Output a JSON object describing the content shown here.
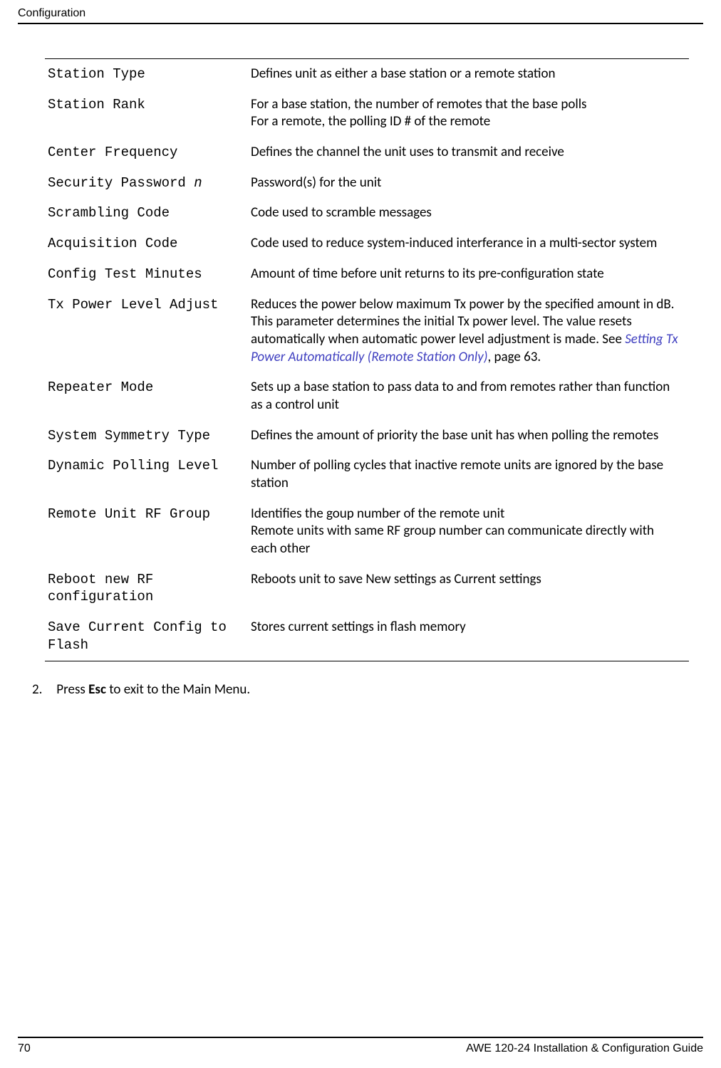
{
  "header": {
    "title": "Configuration"
  },
  "table": {
    "rows": [
      {
        "param": "Station Type",
        "desc": "Defines unit as either a base station or a remote station"
      },
      {
        "param": "Station Rank",
        "desc_lines": [
          "For a base station, the number of remotes that the base polls",
          "For a remote, the polling ID # of the remote"
        ]
      },
      {
        "param": "Center Frequency",
        "desc": "Defines the channel the unit uses to transmit and receive"
      },
      {
        "param_parts": {
          "text": "Security Password ",
          "italic": "n"
        },
        "desc": "Password(s) for the unit"
      },
      {
        "param": "Scrambling Code",
        "desc": "Code used to scramble messages"
      },
      {
        "param": "Acquisition Code",
        "desc": "Code used to reduce system-induced interferance in a multi-sector system"
      },
      {
        "param": "Config Test Minutes",
        "desc": "Amount of time before unit returns to its pre-configuration state"
      },
      {
        "param": "Tx Power Level Adjust",
        "desc_mixed": {
          "before": "Reduces the power below maximum Tx power by the specified amount in dB. This parameter determines the initial Tx power level. The value resets automatically when automatic power level adjustment is made. See ",
          "link": "Setting Tx Power Automatically (Remote Station Only)",
          "after": ", page 63."
        }
      },
      {
        "param": "Repeater Mode",
        "desc": "Sets up a base station to pass data to and from remotes rather than function as a control unit"
      },
      {
        "param": "System Symmetry Type",
        "desc": "Defines the amount of priority the base unit has when polling the remotes"
      },
      {
        "param": "Dynamic Polling Level",
        "desc": "Number of polling cycles that inactive remote units are ignored by the base station"
      },
      {
        "param": "Remote Unit RF Group",
        "desc_lines": [
          "Identifies the goup number of the remote unit",
          "Remote units with same RF group number can communicate directly with each other"
        ]
      },
      {
        "param": "Reboot new RF configuration",
        "desc": "Reboots unit to save New settings as Current settings"
      },
      {
        "param": "Save Current Config to Flash",
        "desc": "Stores current settings in flash memory"
      }
    ]
  },
  "instruction": {
    "num": "2.",
    "before": "Press ",
    "bold": "Esc",
    "after": " to exit to the Main Menu."
  },
  "footer": {
    "page": "70",
    "title": "AWE 120-24 Installation & Configuration Guide"
  }
}
